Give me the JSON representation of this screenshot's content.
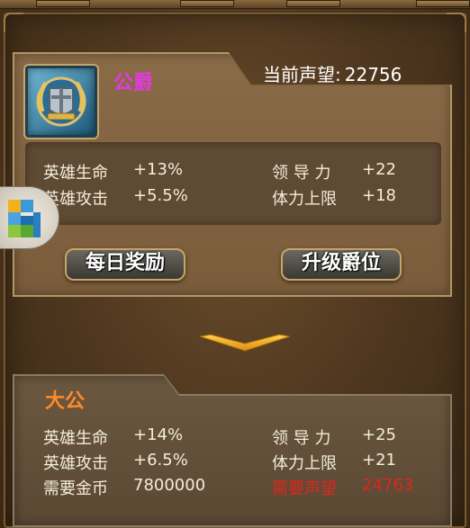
{
  "current_rank": {
    "name": "公爵",
    "reputation_label": "当前声望:",
    "reputation_value": "22756",
    "stats": {
      "hero_life_label": "英雄生命",
      "hero_life_value": "+13%",
      "hero_attack_label": "英雄攻击",
      "hero_attack_value": "+5.5%",
      "leadership_label": "领 导 力",
      "leadership_value": "+22",
      "stamina_cap_label": "体力上限",
      "stamina_cap_value": "+18"
    },
    "daily_reward_button": "每日奖励",
    "upgrade_button": "升级爵位"
  },
  "next_rank": {
    "name": "大公",
    "stats": {
      "hero_life_label": "英雄生命",
      "hero_life_value": "+14%",
      "hero_attack_label": "英雄攻击",
      "hero_attack_value": "+6.5%",
      "gold_required_label": "需要金币",
      "gold_required_value": "7800000",
      "leadership_label": "领 导 力",
      "leadership_value": "+25",
      "stamina_cap_label": "体力上限",
      "stamina_cap_value": "+21",
      "reputation_required_label": "需要声望",
      "reputation_required_value": "24763"
    }
  },
  "icons": {
    "rank_emblem": "helmet-laurel-icon",
    "floating_widget": "g-cube-icon",
    "expand_arrow": "chevron-down-icon"
  },
  "colors": {
    "current_rank_name": "#e23adf",
    "next_rank_name": "#ff8a2a",
    "insufficient_requirement": "#e0261c"
  }
}
